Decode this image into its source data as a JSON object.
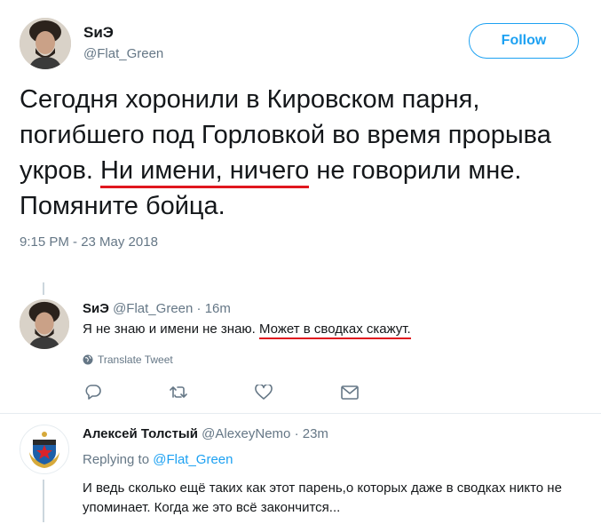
{
  "main_tweet": {
    "author_name": "SиЭ",
    "author_handle": "@Flat_Green",
    "follow_label": "Follow",
    "text_before": "Сегодня хоронили в Кировском парня, погибшего под Горловкой во время прорыва укров. ",
    "text_highlight": "Ни имени, ничего",
    "text_after": " не говорили мне. Помяните бойца.",
    "timestamp": "9:15 PM - 23 May 2018"
  },
  "reply1": {
    "author_name": "SиЭ",
    "author_handle": "@Flat_Green",
    "dot": "·",
    "time": "16m",
    "text_before": "Я не знаю и имени не знаю. ",
    "text_highlight": "Может в сводках скажут.",
    "translate_label": "Translate Tweet"
  },
  "reply2": {
    "author_name": "Алексей Толстый",
    "author_handle": "@AlexeyNemo",
    "dot": "·",
    "time": "23m",
    "replying_label": "Replying to",
    "replying_handle": "@Flat_Green",
    "text": "И ведь сколько ещё таких как этот парень,о которых даже в сводках никто не упоминает. Когда же это всё закончится..."
  },
  "icons": {
    "reply": "reply-icon",
    "retweet": "retweet-icon",
    "like": "heart-icon",
    "dm": "envelope-icon",
    "globe": "globe-icon"
  },
  "colors": {
    "accent": "#1da1f2",
    "highlight_underline": "#e0171f",
    "muted": "#657786"
  }
}
